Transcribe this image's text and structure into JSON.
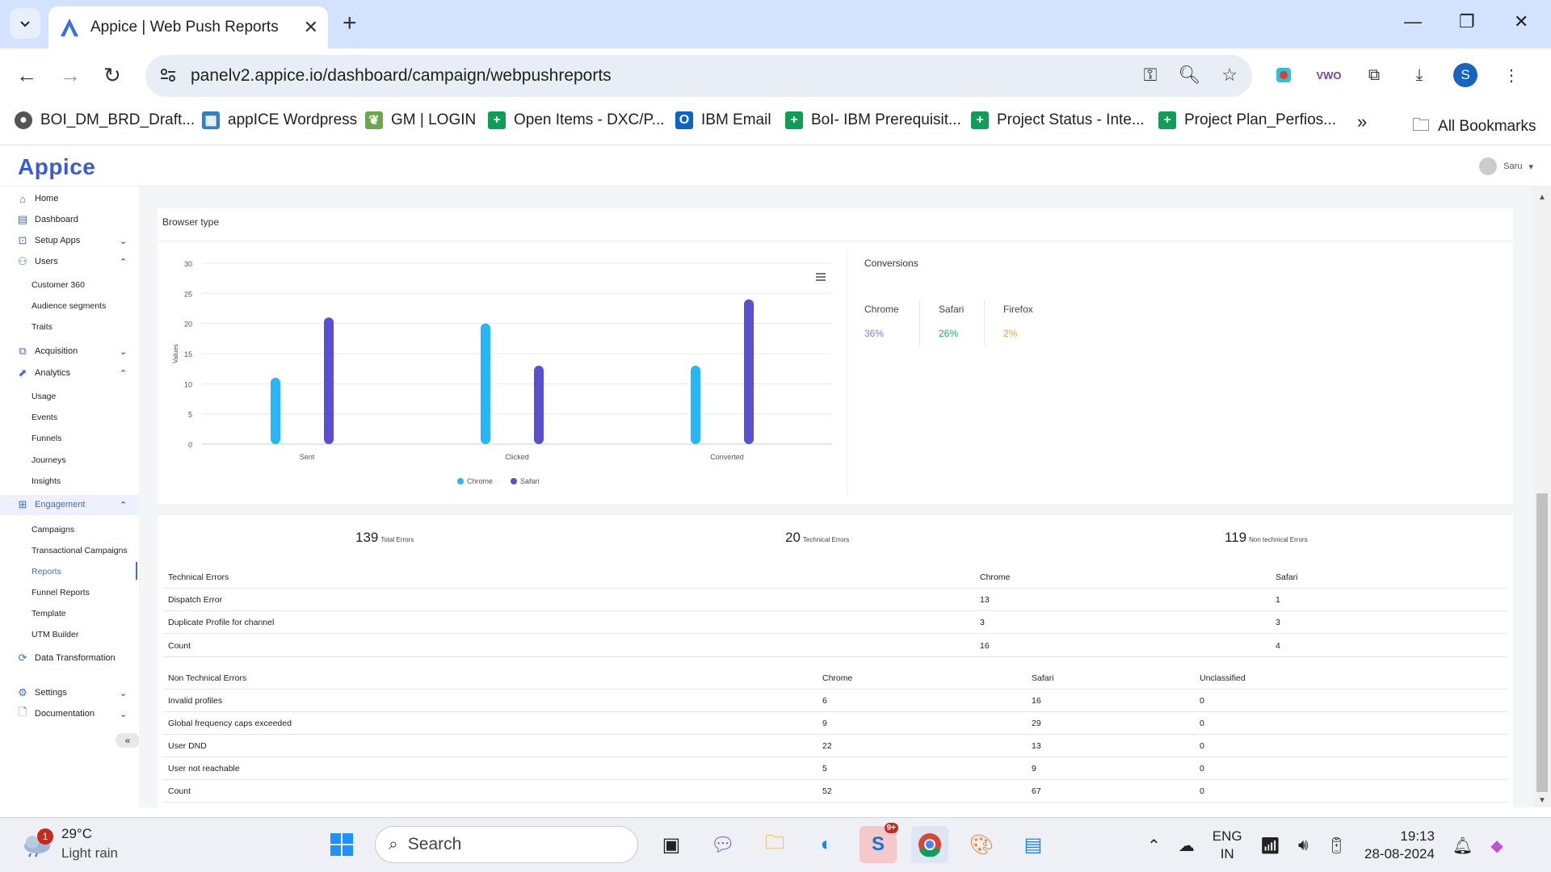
{
  "browser": {
    "tab_title": "Appice | Web Push Reports",
    "url": "panelv2.appice.io/dashboard/campaign/webpushreports",
    "profile_initial": "S",
    "bookmarks": [
      {
        "label": "BOI_DM_BRD_Draft...",
        "icon": "globe-icon",
        "color": "#555555"
      },
      {
        "label": "appICE Wordpress",
        "icon": "image-icon",
        "color": "#2f80c7"
      },
      {
        "label": "GM | LOGIN",
        "icon": "leaf-icon",
        "color": "#6aa84f"
      },
      {
        "label": "Open Items - DXC/P...",
        "icon": "sheets-icon",
        "color": "#0f9d58"
      },
      {
        "label": "IBM Email",
        "icon": "outlook-icon",
        "color": "#0a64c8"
      },
      {
        "label": "BoI- IBM Prerequisit...",
        "icon": "sheets-icon",
        "color": "#0f9d58"
      },
      {
        "label": "Project Status - Inte...",
        "icon": "sheets-icon",
        "color": "#0f9d58"
      },
      {
        "label": "Project Plan_Perfios...",
        "icon": "sheets-icon",
        "color": "#0f9d58"
      }
    ],
    "all_bookmarks": "All Bookmarks"
  },
  "app": {
    "logo": "Appice",
    "user_name": "Saru",
    "sidebar": {
      "items": [
        {
          "label": "Home",
          "icon": "home-icon"
        },
        {
          "label": "Dashboard",
          "icon": "dashboard-icon"
        },
        {
          "label": "Setup Apps",
          "icon": "setup-icon"
        },
        {
          "label": "Users",
          "icon": "user-icon"
        },
        {
          "label": "Acquisition",
          "icon": "acquisition-icon"
        },
        {
          "label": "Analytics",
          "icon": "analytics-icon"
        },
        {
          "label": "Engagement",
          "icon": "engagement-icon"
        },
        {
          "label": "Data Transformation",
          "icon": "refresh-icon"
        },
        {
          "label": "Settings",
          "icon": "gear-icon"
        },
        {
          "label": "Documentation",
          "icon": "document-icon"
        }
      ],
      "users_sub": [
        "Customer 360",
        "Audience segments",
        "Traits"
      ],
      "analytics_sub": [
        "Usage",
        "Events",
        "Funnels",
        "Journeys",
        "Insights"
      ],
      "engagement_sub": [
        "Campaigns",
        "Transactional Campaigns",
        "Reports",
        "Funnel Reports",
        "Template",
        "UTM Builder"
      ],
      "collapse": "«"
    },
    "browser_type": {
      "title": "Browser type",
      "conversions_title": "Conversions",
      "conversions": [
        {
          "browser": "Chrome",
          "value": "36%",
          "color": "#8c7ae6"
        },
        {
          "browser": "Safari",
          "value": "26%",
          "color": "#27ae60"
        },
        {
          "browser": "Firefox",
          "value": "2%",
          "color": "#f39c4a"
        }
      ]
    },
    "errors": {
      "summary": [
        {
          "num": "139",
          "label": "Total Errors"
        },
        {
          "num": "20",
          "label": "Technical Errors"
        },
        {
          "num": "119",
          "label": "Non technical Errors"
        }
      ],
      "technical": {
        "headers": [
          "Technical Errors",
          "Chrome",
          "Safari"
        ],
        "rows": [
          [
            "Dispatch Error",
            "13",
            "1"
          ],
          [
            "Duplicate Profile for channel",
            "3",
            "3"
          ],
          [
            "Count",
            "16",
            "4"
          ]
        ]
      },
      "non_technical": {
        "headers": [
          "Non Technical Errors",
          "Chrome",
          "Safari",
          "Unclassified"
        ],
        "rows": [
          [
            "Invalid profiles",
            "6",
            "16",
            "0"
          ],
          [
            "Global frequency caps exceeded",
            "9",
            "29",
            "0"
          ],
          [
            "User DND",
            "22",
            "13",
            "0"
          ],
          [
            "User not reachable",
            "5",
            "9",
            "0"
          ],
          [
            "Count",
            "52",
            "67",
            "0"
          ]
        ]
      }
    }
  },
  "chart_data": {
    "type": "bar",
    "categories": [
      "Sent",
      "Clicked",
      "Converted"
    ],
    "series": [
      {
        "name": "Chrome",
        "values": [
          11,
          20,
          13
        ],
        "color": "#29b6f6"
      },
      {
        "name": "Safari",
        "values": [
          21,
          13,
          24
        ],
        "color": "#5b4fcf"
      }
    ],
    "ylabel": "Values",
    "ylim": [
      0,
      30
    ],
    "yticks": [
      0,
      5,
      10,
      15,
      20,
      25,
      30
    ],
    "grid": true,
    "legend": "bottom"
  },
  "taskbar": {
    "temp": "29°C",
    "weather": "Light rain",
    "weather_badge": "1",
    "search": "Search",
    "skype_badge": "9+",
    "lang": "ENG",
    "region": "IN",
    "time": "19:13",
    "date": "28-08-2024"
  }
}
